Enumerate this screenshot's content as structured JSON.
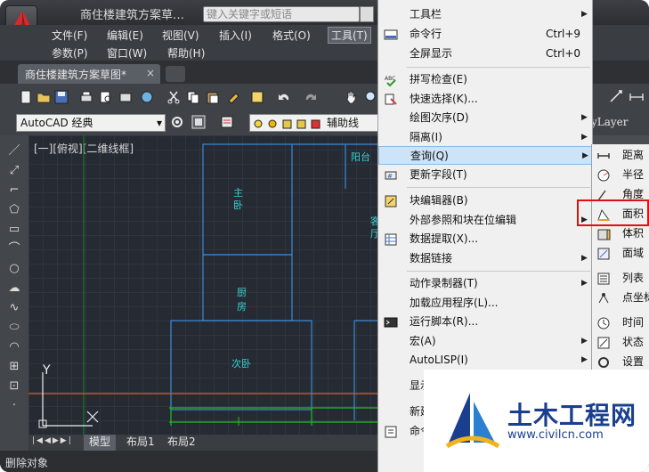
{
  "window": {
    "title": "商住楼建筑方案草…",
    "search_placeholder": "键入关键字或短语"
  },
  "menubar": {
    "row1": [
      "文件(F)",
      "编辑(E)",
      "视图(V)",
      "插入(I)",
      "格式(O)",
      "工具(T)"
    ],
    "row2": [
      "参数(P)",
      "窗口(W)",
      "帮助(H)"
    ],
    "active": "工具(T)"
  },
  "doc_tab": {
    "label": "商住楼建筑方案草图*",
    "close": "×"
  },
  "toolbar": {
    "workspace": "AutoCAD 经典",
    "layer_name": "辅助线",
    "linetype": "yLayer"
  },
  "viewport": {
    "label": "[一][俯视][二维线框]",
    "rooms": [
      "主",
      "卧",
      "厨",
      "房",
      "次卧",
      "阳台",
      "客",
      "厅"
    ],
    "ucs_y": "Y"
  },
  "layout_tabs": [
    "模型",
    "布局1",
    "布局2"
  ],
  "statusbar": {
    "text": "删除对象"
  },
  "tools_menu": {
    "items": [
      {
        "label": "工具栏",
        "shortcut": "",
        "submenu": true
      },
      {
        "label": "命令行",
        "shortcut": "Ctrl+9",
        "submenu": false
      },
      {
        "label": "全屏显示",
        "shortcut": "Ctrl+0",
        "submenu": false
      },
      {
        "label": "拼写检查(E)",
        "shortcut": "",
        "submenu": false
      },
      {
        "label": "快速选择(K)...",
        "shortcut": "",
        "submenu": false
      },
      {
        "label": "绘图次序(D)",
        "shortcut": "",
        "submenu": true
      },
      {
        "label": "隔离(I)",
        "shortcut": "",
        "submenu": true
      },
      {
        "label": "查询(Q)",
        "shortcut": "",
        "submenu": true
      },
      {
        "label": "更新字段(T)",
        "shortcut": "",
        "submenu": false
      },
      {
        "label": "块编辑器(B)",
        "shortcut": "",
        "submenu": false
      },
      {
        "label": "外部参照和块在位编辑",
        "shortcut": "",
        "submenu": true
      },
      {
        "label": "数据提取(X)...",
        "shortcut": "",
        "submenu": false
      },
      {
        "label": "数据链接",
        "shortcut": "",
        "submenu": true
      },
      {
        "label": "动作录制器(T)",
        "shortcut": "",
        "submenu": true
      },
      {
        "label": "加载应用程序(L)...",
        "shortcut": "",
        "submenu": false
      },
      {
        "label": "运行脚本(R)...",
        "shortcut": "",
        "submenu": false
      },
      {
        "label": "宏(A)",
        "shortcut": "",
        "submenu": true
      },
      {
        "label": "AutoLISP(I)",
        "shortcut": "",
        "submenu": true
      },
      {
        "label": "显示",
        "shortcut": "",
        "submenu": false
      },
      {
        "label": "新建",
        "shortcut": "",
        "submenu": false
      },
      {
        "label": "命令",
        "shortcut": "",
        "submenu": false
      }
    ],
    "highlighted": "查询(Q)"
  },
  "query_submenu": {
    "items": [
      "距离",
      "半径",
      "角度",
      "面积",
      "体积",
      "面域",
      "列表",
      "点坐标",
      "时间",
      "状态",
      "设置"
    ],
    "selected": "面积"
  },
  "watermark": {
    "title": "土木工程网",
    "url": "www.civilcn.com"
  },
  "colors": {
    "accent_highlight": "#cde3f7",
    "red_box": "#e01010",
    "viewport_bg": "#252a33",
    "wall_lines": "#3a8ad8",
    "green_lines": "#1ec01e",
    "brand_blue": "#1a3f8f"
  }
}
